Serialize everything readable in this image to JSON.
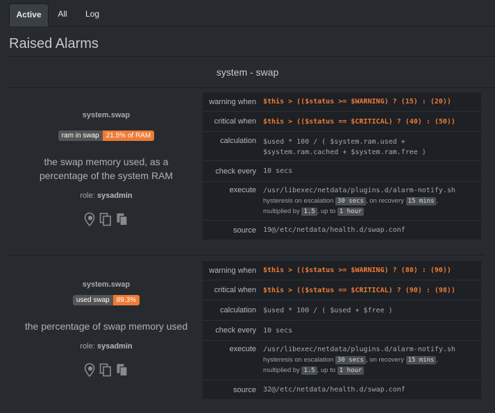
{
  "tabs": [
    {
      "label": "Active"
    },
    {
      "label": "All"
    },
    {
      "label": "Log"
    }
  ],
  "page_title": "Raised Alarms",
  "section_title": "system - swap",
  "labels": {
    "role_prefix": "role:",
    "warning_when": "warning when",
    "critical_when": "critical when",
    "calculation": "calculation",
    "check_every": "check every",
    "execute": "execute",
    "source": "source"
  },
  "alarms": [
    {
      "chart": "system.swap",
      "badge_label": "ram in swap",
      "badge_value": "21.5% of RAM",
      "info": "the swap memory used, as a percentage of the system RAM",
      "role": "sysadmin",
      "warning": "$this > (($status >= $WARNING) ? (15) : (20))",
      "critical": "$this > (($status == $CRITICAL) ? (40) : (50))",
      "calculation_1": "$used * 100 / ( $system.ram.used +",
      "calculation_2": "$system.ram.cached + $system.ram.free )",
      "every": "10 secs",
      "exec": "/usr/libexec/netdata/plugins.d/alarm-notify.sh",
      "hyst_text_1": "hysteresis on escalation",
      "hyst_esc": "30 secs",
      "hyst_text_2": ", on recovery",
      "hyst_rec": "15 mins",
      "hyst_text_3": ",",
      "mult_text_1": "multiplied by",
      "mult": "1.5",
      "mult_text_2": ", up to",
      "mult_max": "1 hour",
      "source": "19@/etc/netdata/health.d/swap.conf"
    },
    {
      "chart": "system.swap",
      "badge_label": "used swap",
      "badge_value": "89.3%",
      "info": "the percentage of swap memory used",
      "role": "sysadmin",
      "warning": "$this > (($status >= $WARNING) ? (80) : (90))",
      "critical": "$this > (($status == $CRITICAL) ? (90) : (98))",
      "calculation_1": "$used * 100 / ( $used + $free )",
      "every": "10 secs",
      "exec": "/usr/libexec/netdata/plugins.d/alarm-notify.sh",
      "hyst_text_1": "hysteresis on escalation",
      "hyst_esc": "30 secs",
      "hyst_text_2": ", on recovery",
      "hyst_rec": "15 mins",
      "hyst_text_3": ",",
      "mult_text_1": "multiplied by",
      "mult": "1.5",
      "mult_text_2": ", up to",
      "mult_max": "1 hour",
      "source": "32@/etc/netdata/health.d/swap.conf"
    }
  ],
  "icons": [
    "locate-icon",
    "copy-icon",
    "copy-all-icon"
  ]
}
